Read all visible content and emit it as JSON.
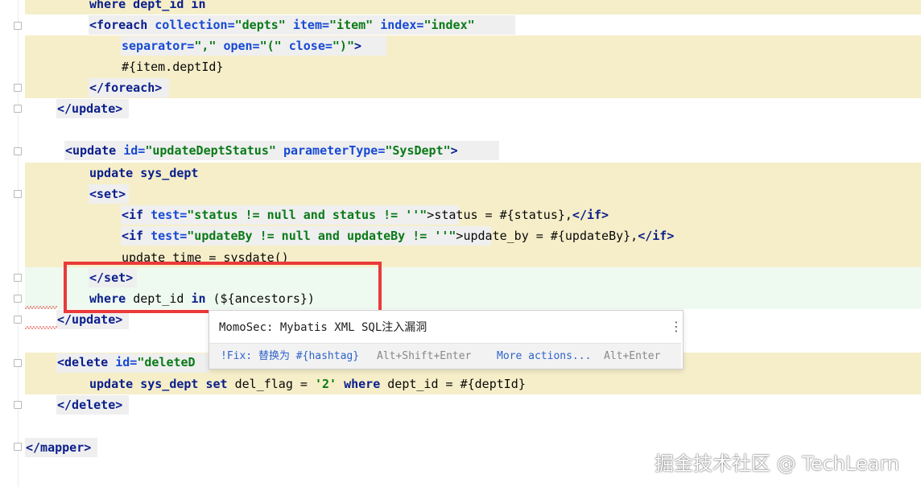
{
  "editor": {
    "lines": [
      [
        "where dept_id in"
      ],
      [
        "<foreach",
        "collection=",
        "\"depts\"",
        "item=",
        "\"item\"",
        "index=",
        "\"index\""
      ],
      [
        "separator=",
        "\",\"",
        "open=",
        "\"(\"",
        "close=",
        "\")\"",
        ">"
      ],
      [
        "#{item.deptId}"
      ],
      [
        "</foreach>"
      ],
      [
        "</update>"
      ],
      [
        "<update",
        "id=",
        "\"updateDeptStatus\"",
        "parameterType=",
        "\"SysDept\"",
        ">"
      ],
      [
        "update sys_dept"
      ],
      [
        "<set>"
      ],
      [
        "<if",
        "test=",
        "\"status != null and status != ''\"",
        ">status = #{status},",
        "</if>"
      ],
      [
        "<if",
        "test=",
        "\"updateBy != null and updateBy != ''\"",
        ">update_by = #{updateBy},",
        "</if>"
      ],
      [
        "update_time = sysdate()"
      ],
      [
        "</set>"
      ],
      [
        "where",
        "dept_id",
        "in",
        "(${ancestors})"
      ],
      [
        "</update>"
      ],
      [
        "<delete",
        "id=",
        "\"deleteD"
      ],
      [
        "update sys_dept",
        "set",
        "del_flag =",
        "'2'",
        "where",
        "dept_id = #{deptId}"
      ],
      [
        "</delete>"
      ],
      [
        "</mapper>"
      ]
    ]
  },
  "popup": {
    "title": "MomoSec: Mybatis XML SQL注入漏洞",
    "menu_icon": "kebab-menu-icon",
    "fix_label": "!Fix: 替换为 #{hashtag}",
    "fix_shortcut": "Alt+Shift+Enter",
    "more_label": "More actions...",
    "more_shortcut": "Alt+Enter"
  },
  "watermark": "掘金技术社区 @ TechLearn",
  "colors": {
    "highlight": "#f6eec9",
    "highlight_green": "#eef9ef",
    "tag": "#0a1e8c",
    "attribute": "#174ad4",
    "string": "#0a7a18",
    "annotation_box": "#ea3a3a",
    "error_squiggle": "#e53935"
  }
}
